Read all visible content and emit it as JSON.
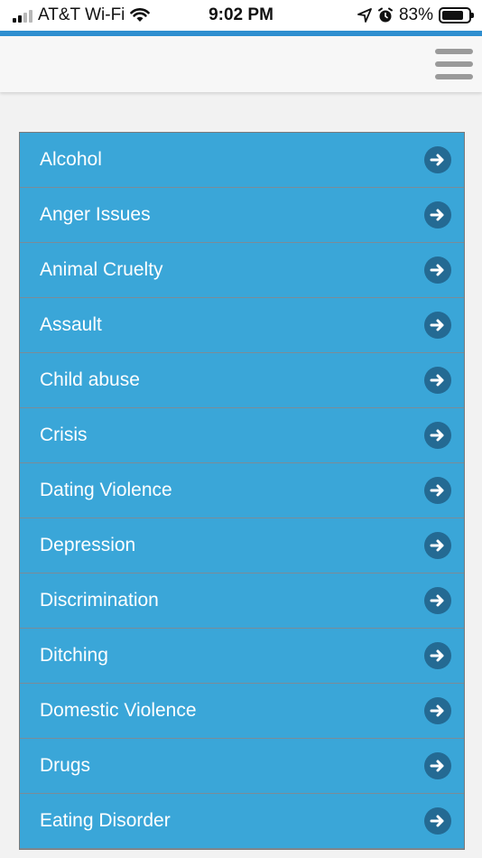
{
  "status_bar": {
    "carrier": "AT&T Wi-Fi",
    "time": "9:02 PM",
    "battery": "83%",
    "battery_level": 0.83
  },
  "header": {
    "menu_icon": "hamburger-menu-icon"
  },
  "topics": [
    {
      "label": "Alcohol"
    },
    {
      "label": "Anger Issues"
    },
    {
      "label": "Animal Cruelty"
    },
    {
      "label": "Assault"
    },
    {
      "label": "Child abuse"
    },
    {
      "label": "Crisis"
    },
    {
      "label": "Dating Violence"
    },
    {
      "label": "Depression"
    },
    {
      "label": "Discrimination"
    },
    {
      "label": "Ditching"
    },
    {
      "label": "Domestic Violence"
    },
    {
      "label": "Drugs"
    },
    {
      "label": "Eating Disorder"
    }
  ],
  "colors": {
    "list_background": "#3aa6d8",
    "arrow_circle": "#246a93",
    "accent": "#2f8fd0"
  }
}
